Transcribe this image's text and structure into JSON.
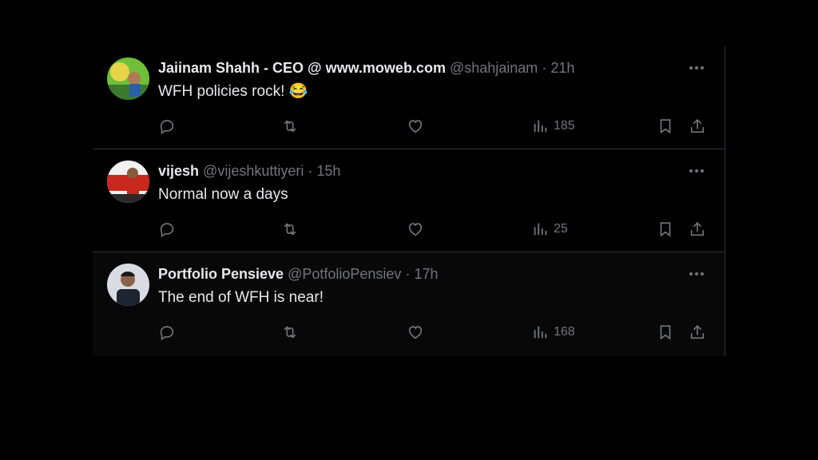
{
  "tweets": [
    {
      "name": "Jaiinam Shahh - CEO @ www.moweb.com",
      "handle": "@shahjainam",
      "separator": "·",
      "time": "21h",
      "text": "WFH policies rock! 😂",
      "views": "185",
      "avatar_colors": [
        "#6fbf3a",
        "#e8d44a",
        "#3b7a2e"
      ]
    },
    {
      "name": "vijesh",
      "handle": "@vijeshkuttiyeri",
      "separator": "·",
      "time": "15h",
      "text": "Normal now a days",
      "views": "25",
      "avatar_colors": [
        "#c8281e",
        "#f2f2f2",
        "#2a2a2a"
      ]
    },
    {
      "name": "Portfolio Pensieve",
      "handle": "@PotfolioPensiev",
      "separator": "·",
      "time": "17h",
      "text": "The end of WFH is near!",
      "views": "168",
      "avatar_colors": [
        "#d9dde3",
        "#1e2430",
        "#5a4636"
      ]
    }
  ],
  "icons": {
    "more": "more-horizontal-icon",
    "reply": "reply-icon",
    "retweet": "retweet-icon",
    "like": "heart-icon",
    "views": "views-chart-icon",
    "bookmark": "bookmark-icon",
    "share": "share-icon"
  },
  "colors": {
    "background": "#000000",
    "text": "#e7e9ea",
    "muted": "#71767b",
    "divider": "#2f3336"
  }
}
